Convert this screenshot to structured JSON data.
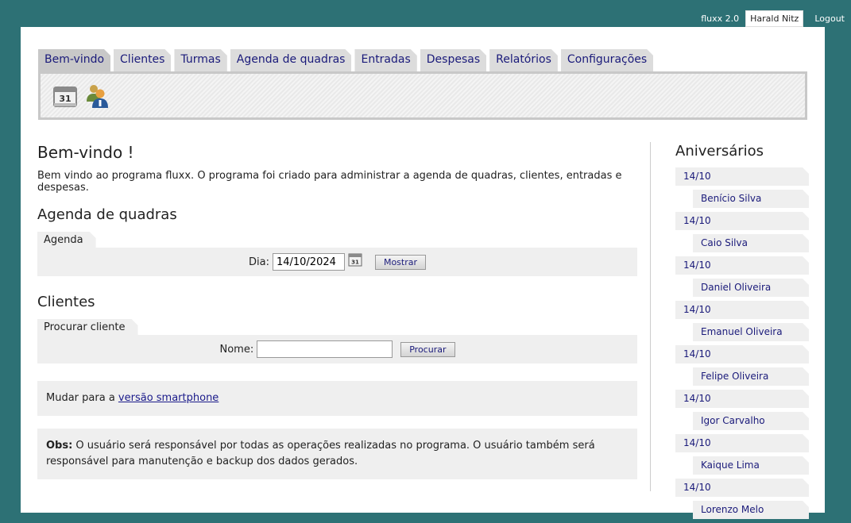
{
  "topbar": {
    "version": "fluxx 2.0",
    "user": "Harald Nitz",
    "logout": "Logout"
  },
  "tabs": [
    {
      "label": "Bem-vindo"
    },
    {
      "label": "Clientes"
    },
    {
      "label": "Turmas"
    },
    {
      "label": "Agenda de quadras"
    },
    {
      "label": "Entradas"
    },
    {
      "label": "Despesas"
    },
    {
      "label": "Relatórios"
    },
    {
      "label": "Configurações"
    }
  ],
  "main": {
    "title": "Bem-vindo !",
    "intro": "Bem vindo ao programa fluxx. O programa foi criado para administrar a agenda de quadras, clientes, entradas e despesas.",
    "agenda": {
      "heading": "Agenda de quadras",
      "panel_label": "Agenda",
      "day_label": "Dia:",
      "day_value": "14/10/2024",
      "button": "Mostrar"
    },
    "clientes": {
      "heading": "Clientes",
      "panel_label": "Procurar cliente",
      "name_label": "Nome:",
      "name_value": "",
      "button": "Procurar"
    },
    "smartphone": {
      "prefix": "Mudar para a ",
      "link": "versão smartphone"
    },
    "obs": {
      "label": "Obs:",
      "text": " O usuário será responsável por todas as operações realizadas no programa. O usuário também será responsável para manutenção e backup dos dados gerados."
    }
  },
  "sidebar": {
    "title": "Aniversários",
    "birthdays": [
      {
        "date": "14/10",
        "name": "Benício Silva"
      },
      {
        "date": "14/10",
        "name": "Caio Silva"
      },
      {
        "date": "14/10",
        "name": "Daniel Oliveira"
      },
      {
        "date": "14/10",
        "name": "Emanuel Oliveira"
      },
      {
        "date": "14/10",
        "name": "Felipe Oliveira"
      },
      {
        "date": "14/10",
        "name": "Igor Carvalho"
      },
      {
        "date": "14/10",
        "name": "Kaique Lima"
      },
      {
        "date": "14/10",
        "name": "Lorenzo Melo"
      }
    ]
  },
  "icons": [
    "calendar-icon",
    "users-icon"
  ]
}
